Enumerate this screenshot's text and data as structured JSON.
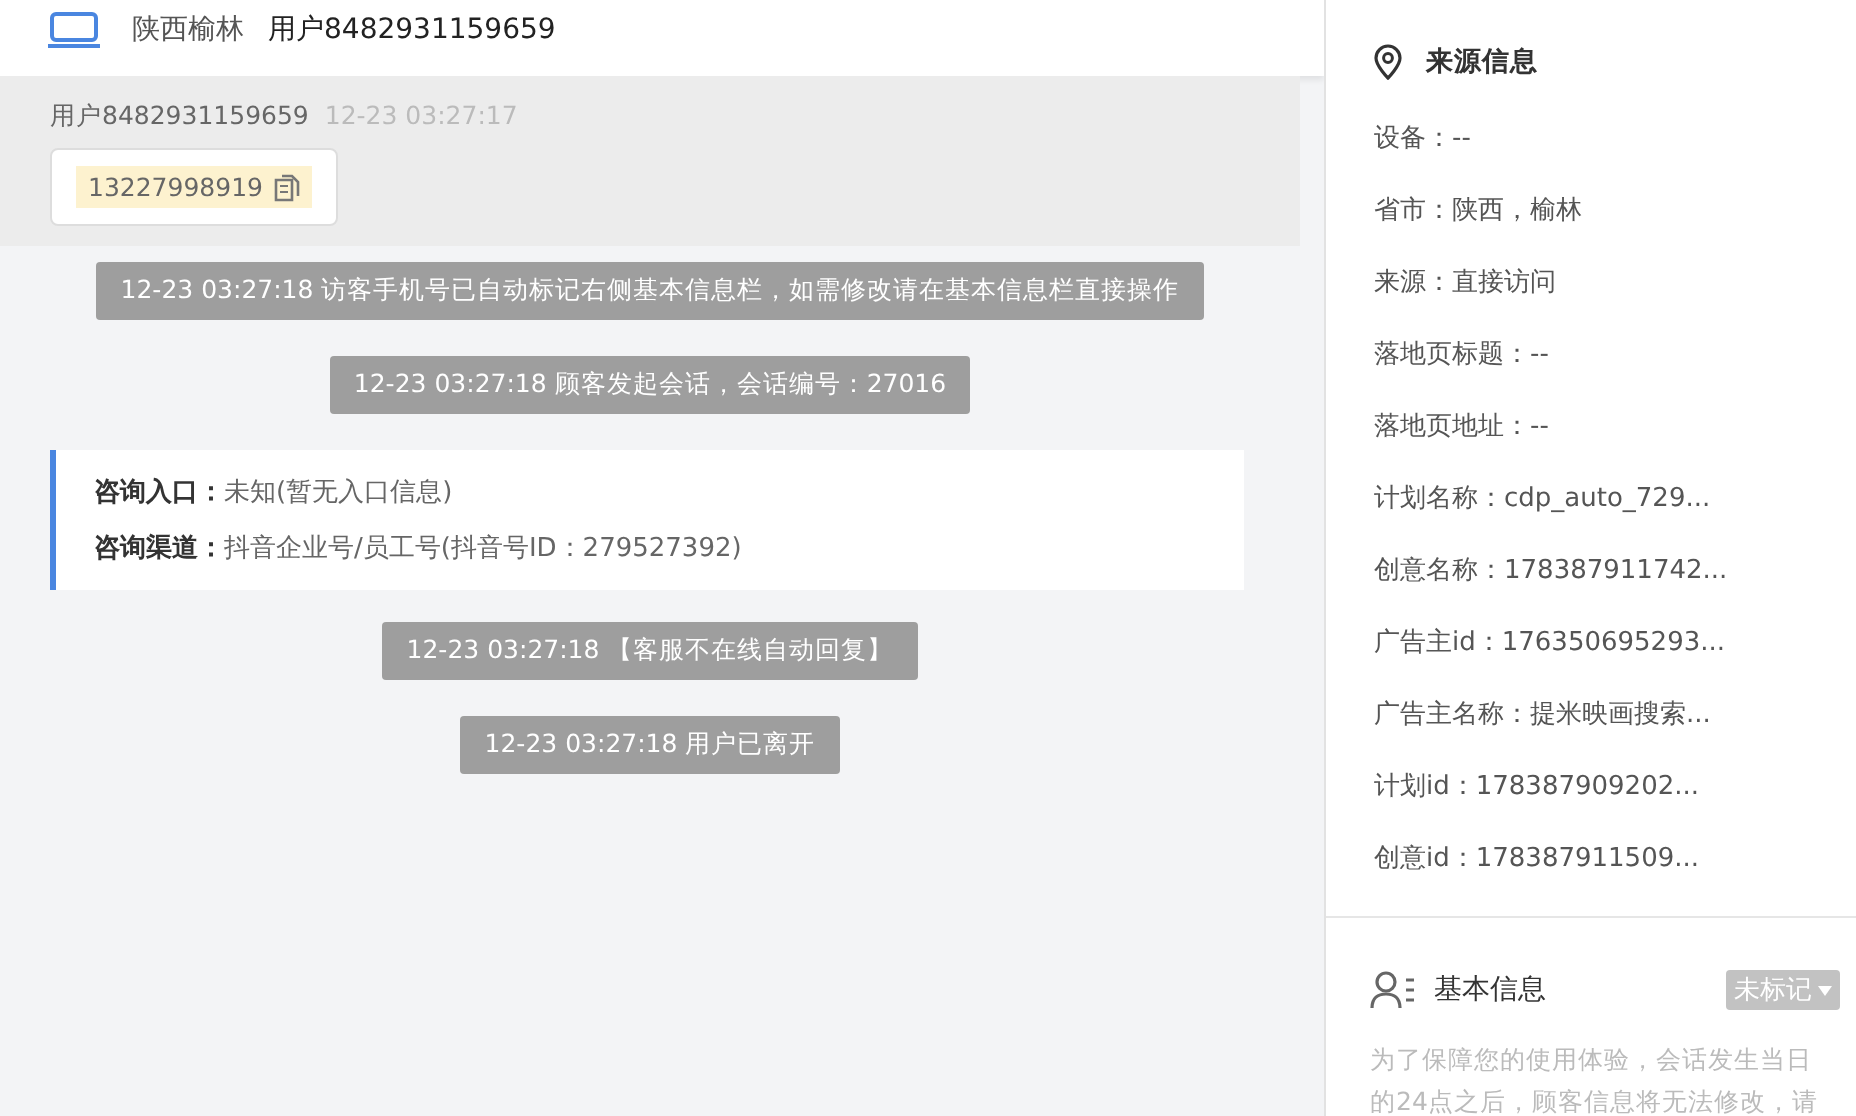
{
  "header": {
    "location": "陕西榆林",
    "user": "用户8482931159659"
  },
  "message": {
    "sender": "用户8482931159659",
    "time": "12-23 03:27:17",
    "phone": "13227998919"
  },
  "events": [
    {
      "kind": "notice",
      "text": "12-23 03:27:18 访客手机号已自动标记右侧基本信息栏，如需修改请在基本信息栏直接操作"
    },
    {
      "kind": "notice",
      "text": "12-23 03:27:18 顾客发起会话，会话编号：27016"
    },
    {
      "kind": "card",
      "lines": [
        {
          "label": "咨询入口：",
          "value": "未知(暂无入口信息)"
        },
        {
          "label": "咨询渠道：",
          "value": "抖音企业号/员工号(抖音号ID：279527392)"
        }
      ]
    },
    {
      "kind": "notice",
      "text": "12-23 03:27:18 【客服不在线自动回复】"
    },
    {
      "kind": "notice",
      "text": "12-23 03:27:18 用户已离开"
    }
  ],
  "source_info": {
    "title": "来源信息",
    "fields": [
      "设备：--",
      "省市：陕西，榆林",
      "来源：直接访问",
      "落地页标题：--",
      "落地页地址：--",
      "计划名称：cdp_auto_729...",
      "创意名称：178387911742...",
      "广告主id：176350695293...",
      "广告主名称：提米映画搜索...",
      "计划id：178387909202...",
      "创意id：178387911509..."
    ]
  },
  "basic_info": {
    "title": "基本信息",
    "tag": "未标记",
    "note": "为了保障您的使用体验，会话发生当日的24点之后，顾客信息将无法修改，请"
  }
}
